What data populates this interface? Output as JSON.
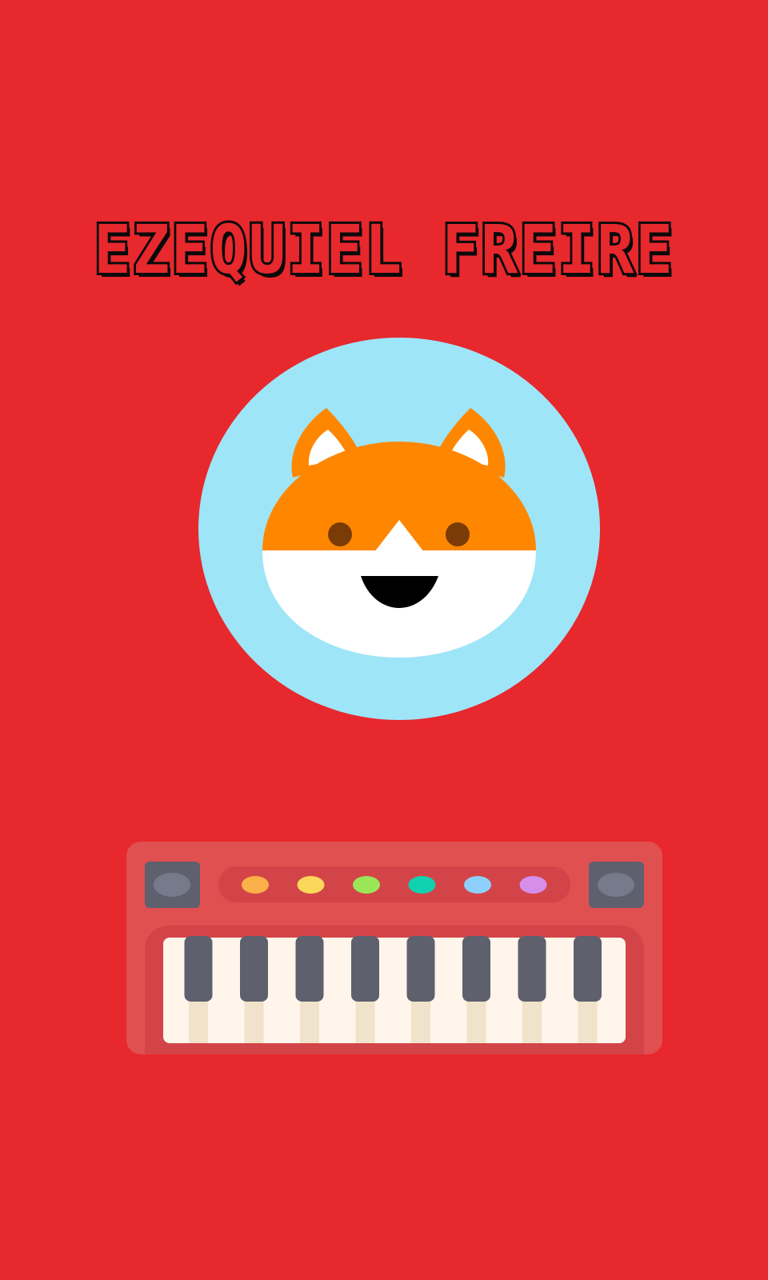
{
  "page": {
    "title": "EZEQUIEL FREIRE"
  },
  "colors": {
    "background": "#e7282d",
    "avatar_circle": "#9ee5f7",
    "fox_orange": "#ff8700",
    "fox_white": "#ffffff",
    "fox_eyes": "#7a3b07",
    "fox_mouth": "#000000",
    "keyboard_body": "#e05050",
    "keyboard_inner": "#d34448",
    "knob_dark": "#5e606e",
    "knob_light": "#767a8a",
    "white_key": "#fff5ea",
    "white_key_stripe": "#f1e2cb",
    "black_key": "#5e606e"
  },
  "avatar": {
    "icon": "fox-icon"
  },
  "keyboard": {
    "icon": "keyboard-icon",
    "buttons": [
      {
        "name": "orange",
        "color": "#fbb04a"
      },
      {
        "name": "yellow",
        "color": "#fbd85a"
      },
      {
        "name": "green",
        "color": "#9be657"
      },
      {
        "name": "teal",
        "color": "#10d2b0"
      },
      {
        "name": "blue",
        "color": "#8ed0fc"
      },
      {
        "name": "purple",
        "color": "#d78ee9"
      }
    ],
    "black_keys": 8
  }
}
